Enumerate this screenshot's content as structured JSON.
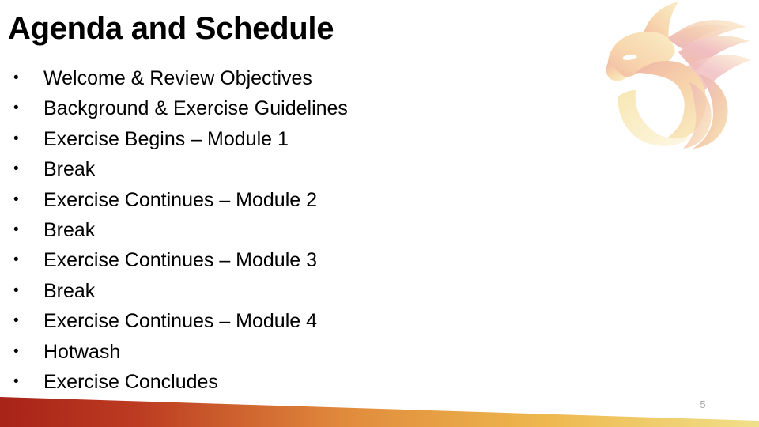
{
  "slide": {
    "title": "Agenda and Schedule",
    "page_number": "5",
    "background_color": "#ffffff",
    "text_color": "#000000",
    "page_number_color": "#a6a6a6"
  },
  "bullets": [
    {
      "marker": "•",
      "text": "Welcome & Review Objectives"
    },
    {
      "marker": "•",
      "text": "Background & Exercise Guidelines"
    },
    {
      "marker": "•",
      "text": "Exercise Begins – Module 1"
    },
    {
      "marker": "•",
      "text": "Break"
    },
    {
      "marker": "•",
      "text": "Exercise Continues – Module 2"
    },
    {
      "marker": "•",
      "text": "Break"
    },
    {
      "marker": "•",
      "text": "Exercise Continues – Module 3"
    },
    {
      "marker": "•",
      "text": "Break"
    },
    {
      "marker": "•",
      "text": "Exercise Continues – Module 4"
    },
    {
      "marker": "•",
      "text": "Hotwash"
    },
    {
      "marker": "•",
      "text": "Exercise Concludes"
    }
  ],
  "logo": {
    "name": "phoenix-logo",
    "description": "stylized phoenix / eagle watermark",
    "colors": {
      "gold": "#f7e3a8",
      "peach": "#f8cfa4",
      "salmon": "#f2b79c",
      "pink": "#edb8bd",
      "rose": "#e8adb6",
      "cream": "#fdf3de"
    }
  },
  "bottom_bar": {
    "name": "decorative-gradient-wedge",
    "gradient_stops": [
      {
        "offset": "0%",
        "color": "#a82318"
      },
      {
        "offset": "18%",
        "color": "#bc3b21"
      },
      {
        "offset": "45%",
        "color": "#e08a3c"
      },
      {
        "offset": "72%",
        "color": "#eeb84e"
      },
      {
        "offset": "100%",
        "color": "#f0e08a"
      }
    ]
  }
}
